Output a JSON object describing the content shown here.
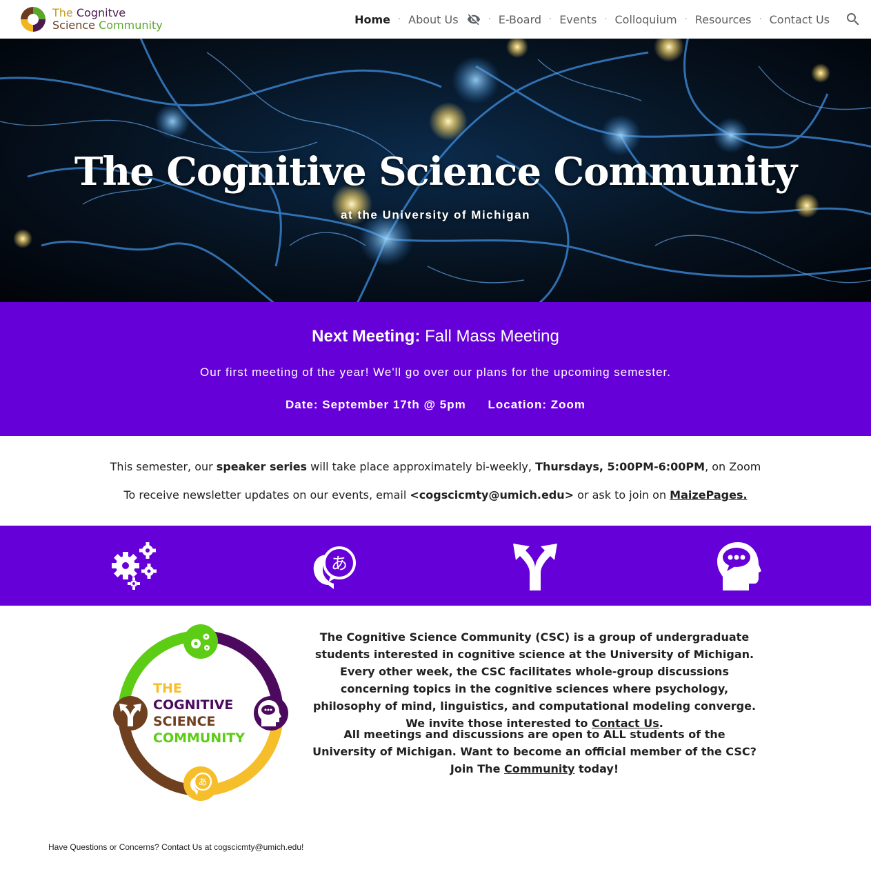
{
  "site": {
    "logo_line1_a": "The",
    "logo_line1_b": "Cognitve",
    "logo_line2_a": "Science",
    "logo_line2_b": "Community"
  },
  "nav": {
    "items": [
      {
        "label": "Home"
      },
      {
        "label": "About Us"
      },
      {
        "label": "E-Board"
      },
      {
        "label": "Events"
      },
      {
        "label": "Colloquium"
      },
      {
        "label": "Resources"
      },
      {
        "label": "Contact Us"
      }
    ],
    "separator": "·"
  },
  "hero": {
    "title": "The Cognitive Science Community",
    "subtitle": "at the University of Michigan"
  },
  "meeting": {
    "heading_label": "Next Meeting:",
    "heading_value": "Fall Mass Meeting",
    "description": "Our first meeting of the year! We'll go over our plans for the upcoming semester.",
    "date": "Date: September 17th @ 5pm",
    "location": "Location: Zoom"
  },
  "info": {
    "line1_pre": "This semester, our ",
    "line1_bold1": "speaker series",
    "line1_mid": " will take place approximately bi-weekly, ",
    "line1_bold2": "Thursdays, 5:00PM-6:00PM",
    "line1_post": ", on Zoom",
    "line2_pre": "To receive newsletter updates on our events, email ",
    "line2_email": "<cogscicmty@umich.edu>",
    "line2_mid": " or ask to join on ",
    "line2_link": "MaizePages."
  },
  "badge": {
    "line1": "THE",
    "line2": "COGNITIVE",
    "line3": "SCIENCE",
    "line4": "COMMUNITY",
    "glyph": "あ"
  },
  "about": {
    "p1_text": "The Cognitive Science Community (CSC) is a group of undergraduate students interested in cognitive science at the University of Michigan. Every other week, the CSC facilitates whole-group discussions concerning topics in the cognitive sciences where psychology, philosophy of mind, linguistics, and computational modeling converge. We invite those interested to ",
    "p1_link": "Contact Us",
    "p1_end": ".",
    "p2_text": "All meetings and discussions are open to ALL students of the University of Michigan. Want to become an official member of the CSC? Join The ",
    "p2_link": "Community",
    "p2_end": " today!"
  },
  "footer": {
    "text": "Have Questions or Concerns? Contact Us at cogscicmty@umich.edu!"
  },
  "colors": {
    "purple": "#6600d9",
    "green": "#5ccc14",
    "dark_purple": "#4b0a5e",
    "gold": "#f6be2a",
    "brown": "#6e4020"
  },
  "icons": [
    "gears-icon",
    "speech-language-icon",
    "fork-arrows-icon",
    "head-thought-icon"
  ]
}
